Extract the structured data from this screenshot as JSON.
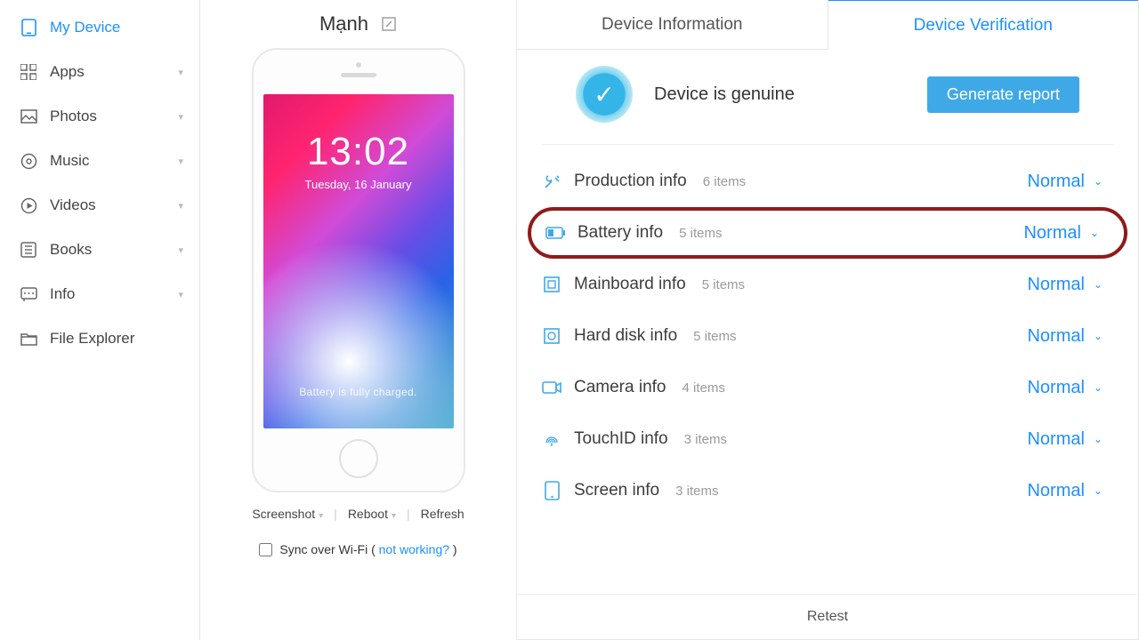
{
  "sidebar": {
    "items": [
      {
        "label": "My Device",
        "icon": "device"
      },
      {
        "label": "Apps",
        "icon": "apps",
        "chevron": true
      },
      {
        "label": "Photos",
        "icon": "photos",
        "chevron": true
      },
      {
        "label": "Music",
        "icon": "music",
        "chevron": true
      },
      {
        "label": "Videos",
        "icon": "videos",
        "chevron": true
      },
      {
        "label": "Books",
        "icon": "books",
        "chevron": true
      },
      {
        "label": "Info",
        "icon": "info",
        "chevron": true
      },
      {
        "label": "File Explorer",
        "icon": "folder"
      }
    ]
  },
  "device": {
    "name": "Mạnh",
    "screen_time": "13:02",
    "screen_date": "Tuesday, 16 January",
    "screen_status": "Battery is fully charged.",
    "actions": {
      "screenshot": "Screenshot",
      "reboot": "Reboot",
      "refresh": "Refresh"
    },
    "sync_label": "Sync over Wi-Fi ( ",
    "sync_link": "not working?",
    "sync_label_end": " )"
  },
  "tabs": {
    "info": "Device Information",
    "verify": "Device Verification"
  },
  "verify": {
    "genuine_text": "Device is  genuine",
    "generate_btn": "Generate report",
    "retest": "Retest",
    "status_label": "Normal",
    "rows": [
      {
        "title": "Production info",
        "count": "6 items"
      },
      {
        "title": "Battery info",
        "count": "5 items"
      },
      {
        "title": "Mainboard info",
        "count": "5 items"
      },
      {
        "title": "Hard disk info",
        "count": "5 items"
      },
      {
        "title": "Camera info",
        "count": "4 items"
      },
      {
        "title": "TouchID info",
        "count": "3 items"
      },
      {
        "title": "Screen info",
        "count": "3 items"
      }
    ]
  }
}
